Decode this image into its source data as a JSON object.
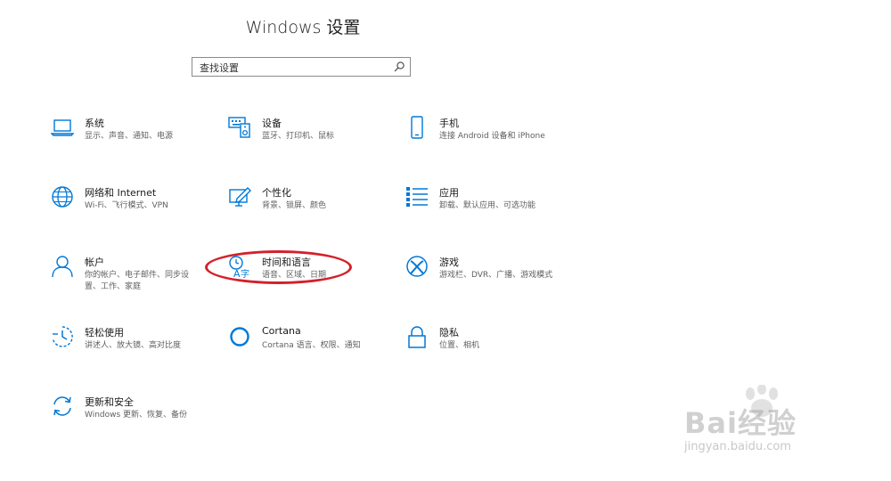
{
  "window": {
    "title": "Windows 设置"
  },
  "search": {
    "placeholder": "查找设置"
  },
  "tiles": [
    {
      "label": "系统",
      "desc": "显示、声音、通知、电源",
      "icon": "laptop-icon"
    },
    {
      "label": "设备",
      "desc": "蓝牙、打印机、鼠标",
      "icon": "keyboard-speaker-icon"
    },
    {
      "label": "手机",
      "desc": "连接 Android 设备和 iPhone",
      "icon": "phone-icon"
    },
    {
      "label": "网络和 Internet",
      "desc": "Wi-Fi、飞行模式、VPN",
      "icon": "globe-icon"
    },
    {
      "label": "个性化",
      "desc": "背景、锁屏、颜色",
      "icon": "paint-icon"
    },
    {
      "label": "应用",
      "desc": "卸载、默认应用、可选功能",
      "icon": "app-list-icon"
    },
    {
      "label": "帐户",
      "desc": "你的帐户、电子邮件、同步设置、工作、家庭",
      "icon": "person-icon"
    },
    {
      "label": "时间和语言",
      "desc": "语音、区域、日期",
      "icon": "time-language-icon"
    },
    {
      "label": "游戏",
      "desc": "游戏栏、DVR、广播、游戏模式",
      "icon": "xbox-icon"
    },
    {
      "label": "轻松使用",
      "desc": "讲述人、放大镜、高对比度",
      "icon": "ease-of-access-icon"
    },
    {
      "label": "Cortana",
      "desc": "Cortana 语言、权限、通知",
      "icon": "cortana-ring-icon"
    },
    {
      "label": "隐私",
      "desc": "位置、相机",
      "icon": "lock-icon"
    },
    {
      "label": "更新和安全",
      "desc": "Windows 更新、恢复、备份",
      "icon": "sync-icon"
    }
  ],
  "watermark": {
    "main": "Bai经验",
    "sub": "jingyan.baidu.com"
  },
  "colors": {
    "accent": "#0078d7",
    "highlight": "#d4202a"
  }
}
